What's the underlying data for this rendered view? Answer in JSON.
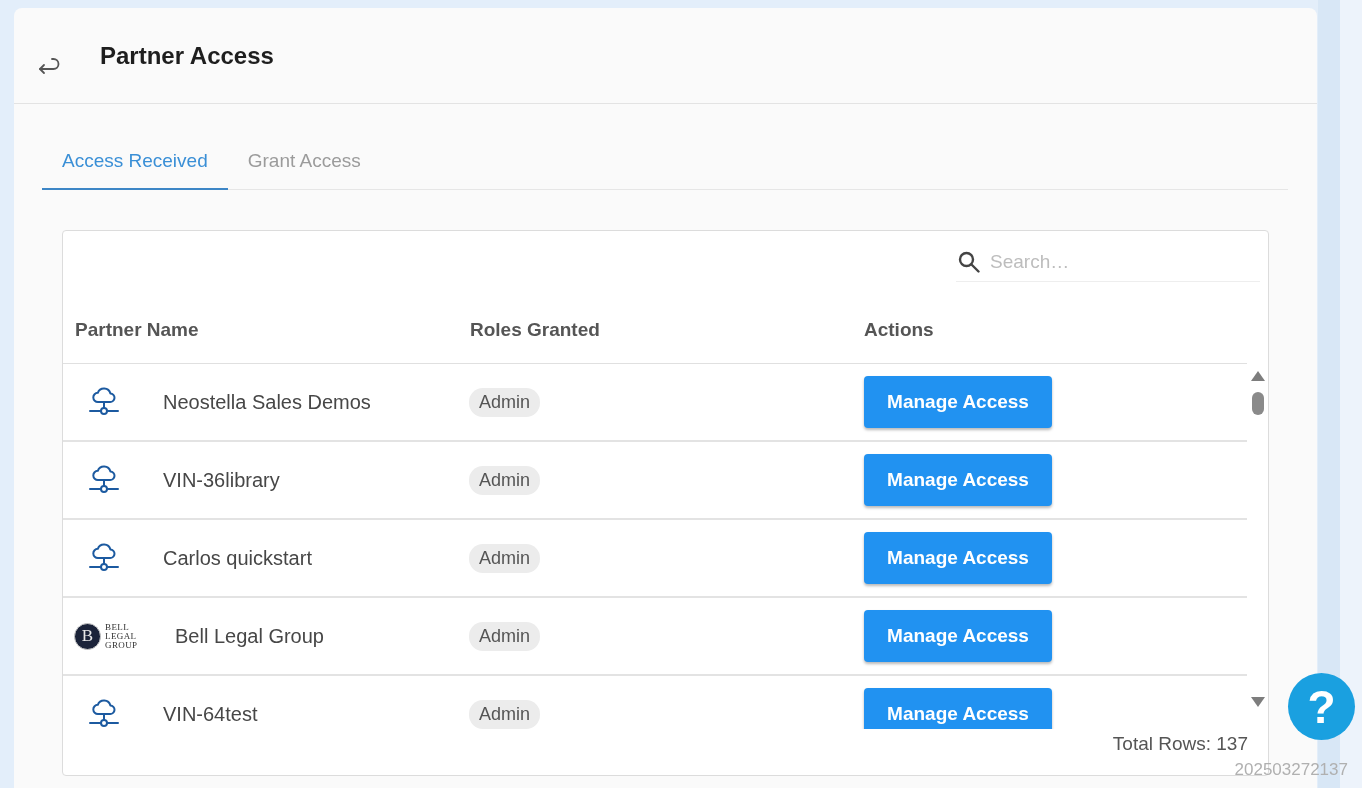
{
  "page": {
    "title": "Partner Access"
  },
  "tabs": [
    {
      "label": "Access Received",
      "selected": true
    },
    {
      "label": "Grant Access",
      "selected": false
    }
  ],
  "search": {
    "placeholder": "Search…"
  },
  "table": {
    "columns": [
      "Partner Name",
      "Roles Granted",
      "Actions"
    ],
    "rows": [
      {
        "avatar": {
          "kind": "cloud"
        },
        "name": "Neostella Sales Demos",
        "role": "Admin",
        "action": "Manage Access"
      },
      {
        "avatar": {
          "kind": "cloud"
        },
        "name": "VIN-36library",
        "role": "Admin",
        "action": "Manage Access"
      },
      {
        "avatar": {
          "kind": "cloud"
        },
        "name": "Carlos quickstart",
        "role": "Admin",
        "action": "Manage Access"
      },
      {
        "avatar": {
          "kind": "logo",
          "initial": "B",
          "wordmark": "BELL LEGAL GROUP"
        },
        "name": "Bell Legal Group",
        "role": "Admin",
        "action": "Manage Access"
      },
      {
        "avatar": {
          "kind": "cloud"
        },
        "name": "VIN-64test",
        "role": "Admin",
        "action": "Manage Access"
      }
    ]
  },
  "footer": {
    "total_rows": "Total Rows: 137"
  },
  "help_button": {
    "label": "?"
  },
  "version_stamp": "202503272137"
}
